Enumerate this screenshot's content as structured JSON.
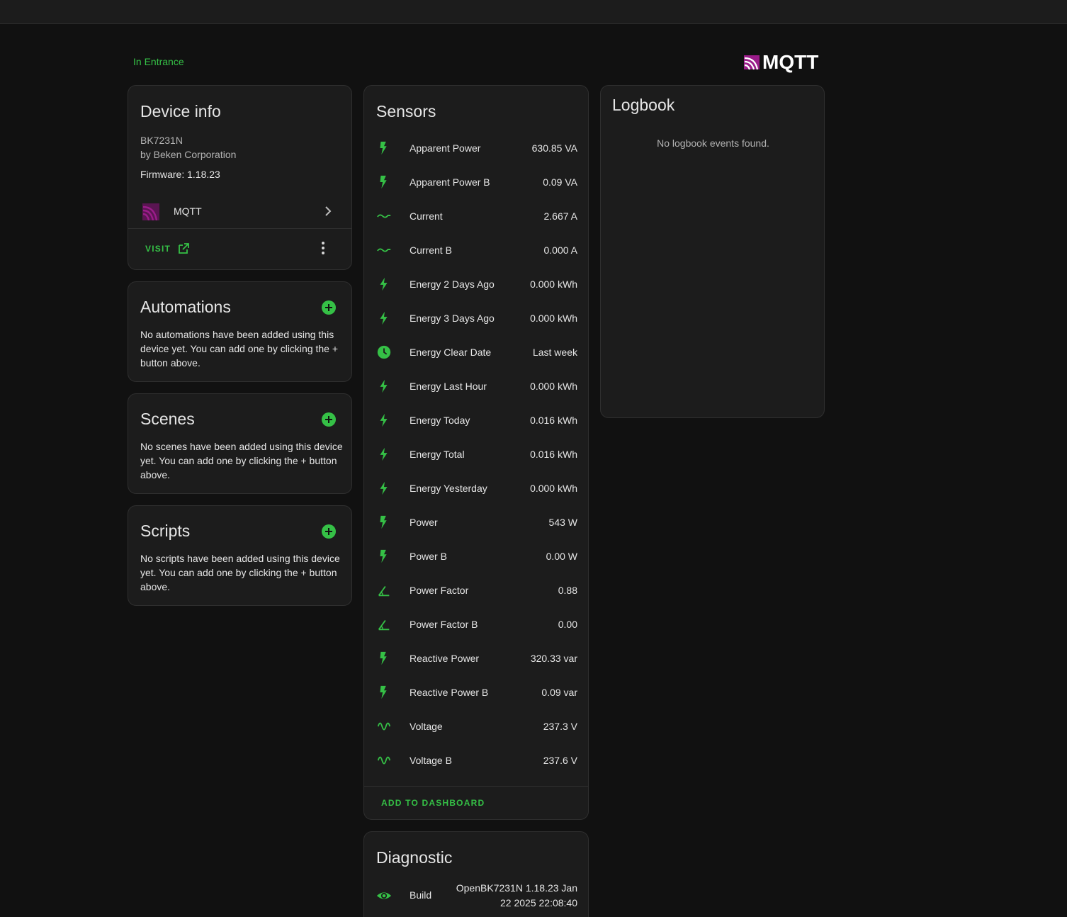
{
  "area_link": "In Entrance",
  "brand": {
    "name": "MQTT",
    "color": "#9b1c8a"
  },
  "accent_color": "#35c046",
  "device_info": {
    "title": "Device info",
    "model": "BK7231N",
    "manufacturer": "by Beken Corporation",
    "firmware": "Firmware: 1.18.23",
    "integration": "MQTT",
    "visit_label": "VISIT"
  },
  "automations": {
    "title": "Automations",
    "description": "No automations have been added using this device yet. You can add one by clicking the + button above."
  },
  "scenes": {
    "title": "Scenes",
    "description": "No scenes have been added using this device yet. You can add one by clicking the + button above."
  },
  "scripts": {
    "title": "Scripts",
    "description": "No scripts have been added using this device yet. You can add one by clicking the + button above."
  },
  "sensors": {
    "title": "Sensors",
    "items": [
      {
        "name": "Apparent Power",
        "value": "630.85 VA",
        "icon": "flash-icon"
      },
      {
        "name": "Apparent Power B",
        "value": "0.09 VA",
        "icon": "flash-icon"
      },
      {
        "name": "Current",
        "value": "2.667 A",
        "icon": "current-ac-icon"
      },
      {
        "name": "Current B",
        "value": "0.000 A",
        "icon": "current-ac-icon"
      },
      {
        "name": "Energy 2 Days Ago",
        "value": "0.000 kWh",
        "icon": "lightning-icon"
      },
      {
        "name": "Energy 3 Days Ago",
        "value": "0.000 kWh",
        "icon": "lightning-icon"
      },
      {
        "name": "Energy Clear Date",
        "value": "Last week",
        "icon": "clock-icon"
      },
      {
        "name": "Energy Last Hour",
        "value": "0.000 kWh",
        "icon": "lightning-icon"
      },
      {
        "name": "Energy Today",
        "value": "0.016 kWh",
        "icon": "lightning-icon"
      },
      {
        "name": "Energy Total",
        "value": "0.016 kWh",
        "icon": "lightning-icon"
      },
      {
        "name": "Energy Yesterday",
        "value": "0.000 kWh",
        "icon": "lightning-icon"
      },
      {
        "name": "Power",
        "value": "543 W",
        "icon": "flash-icon"
      },
      {
        "name": "Power B",
        "value": "0.00 W",
        "icon": "flash-icon"
      },
      {
        "name": "Power Factor",
        "value": "0.88",
        "icon": "angle-icon"
      },
      {
        "name": "Power Factor B",
        "value": "0.00",
        "icon": "angle-icon"
      },
      {
        "name": "Reactive Power",
        "value": "320.33 var",
        "icon": "flash-icon"
      },
      {
        "name": "Reactive Power B",
        "value": "0.09 var",
        "icon": "flash-icon"
      },
      {
        "name": "Voltage",
        "value": "237.3 V",
        "icon": "sine-wave-icon"
      },
      {
        "name": "Voltage B",
        "value": "237.6 V",
        "icon": "sine-wave-icon"
      }
    ],
    "add_to_dashboard": "ADD TO DASHBOARD"
  },
  "diagnostic": {
    "title": "Diagnostic",
    "items": [
      {
        "name": "Build",
        "value": "OpenBK7231N 1.18.23 Jan 22 2025 22:08:40",
        "icon": "eye-icon"
      }
    ]
  },
  "logbook": {
    "title": "Logbook",
    "empty_message": "No logbook events found."
  }
}
